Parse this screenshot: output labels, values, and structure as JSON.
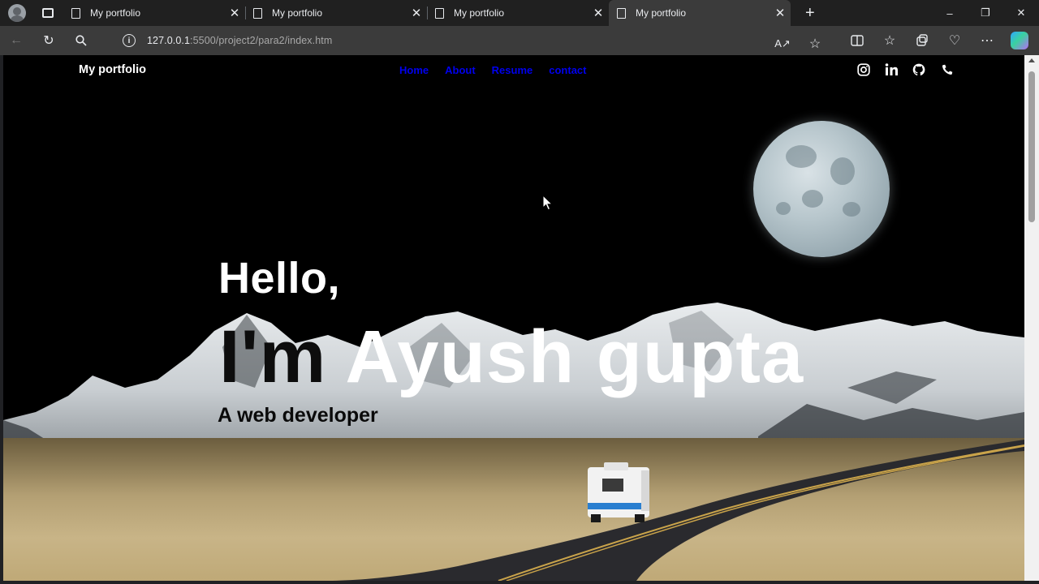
{
  "browser": {
    "tabs": [
      {
        "title": "My portfolio",
        "active": false
      },
      {
        "title": "My portfolio",
        "active": false
      },
      {
        "title": "My portfolio",
        "active": false
      },
      {
        "title": "My portfolio",
        "active": true
      }
    ],
    "address": {
      "host": "127.0.0.1",
      "path": ":5500/project2/para2/index.htm"
    }
  },
  "page": {
    "brand": "My portfolio",
    "nav": [
      "Home",
      "About",
      "Resume",
      "contact"
    ],
    "nav_link_color": "#0000ee",
    "social_icons": [
      "instagram-icon",
      "linkedin-icon",
      "github-icon",
      "phone-icon"
    ],
    "hero": {
      "greeting": "Hello,",
      "intro": "I'm",
      "name": "Ayush gupta",
      "tagline": "A web developer"
    }
  }
}
